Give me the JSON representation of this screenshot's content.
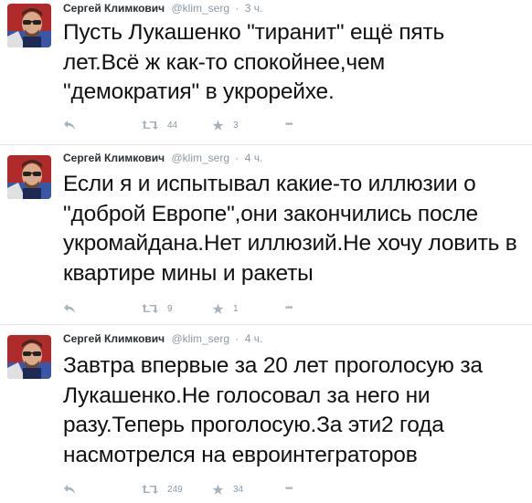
{
  "tweets": [
    {
      "author": "Сергей Климкович",
      "handle": "@klim_serg",
      "separator": "·",
      "time": "3 ч.",
      "text": "Пусть Лукашенко \"тиранит\" ещё пять лет.Всё ж как-то спокойнее,чем \"демократия\" в укрорейхе.",
      "retweets": "44",
      "favorites": "3",
      "more": "•••"
    },
    {
      "author": "Сергей Климкович",
      "handle": "@klim_serg",
      "separator": "·",
      "time": "4 ч.",
      "text": "Если я и испытывал какие-то иллюзии о \"доброй Европе\",они закончились после укромайдана.Нет иллюзий.Не хочу ловить в квартире мины и ракеты",
      "retweets": "9",
      "favorites": "1",
      "more": "•••"
    },
    {
      "author": "Сергей Климкович",
      "handle": "@klim_serg",
      "separator": "·",
      "time": "4 ч.",
      "text": "Завтра впервые за 20 лет проголосую за Лукашенко.Не голосовал за него ни разу.Теперь проголосую.За эти2 года насмотрелся на евроинтеграторов",
      "retweets": "249",
      "favorites": "34",
      "more": "•••"
    }
  ],
  "icons": {
    "reply": "reply-icon",
    "retweet": "retweet-icon",
    "favorite": "star-icon",
    "more": "more-icon"
  },
  "colors": {
    "icon_gray": "#8899a6",
    "divider": "#e1e8ed",
    "text": "#111111"
  }
}
